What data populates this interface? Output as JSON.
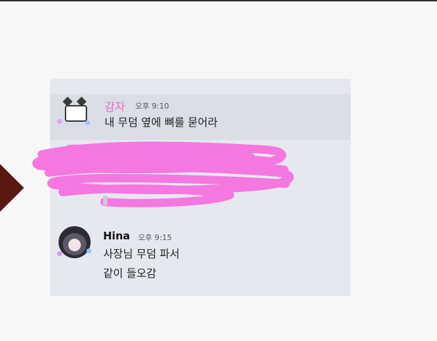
{
  "messages": [
    {
      "author": "감자",
      "time": "오후 9:10",
      "lines": [
        "내 무덤 옆에 뼈를 묻어라"
      ],
      "author_color": "#e36ec9"
    },
    {
      "author": "Hina",
      "time": "오후 9:15",
      "lines": [
        "사장님 무덤 파서",
        "같이 들오감"
      ],
      "author_color": "#111111"
    }
  ],
  "colors": {
    "card": "#e6e8ef",
    "highlight": "#dcdee6",
    "scribble": "#f478e0"
  }
}
